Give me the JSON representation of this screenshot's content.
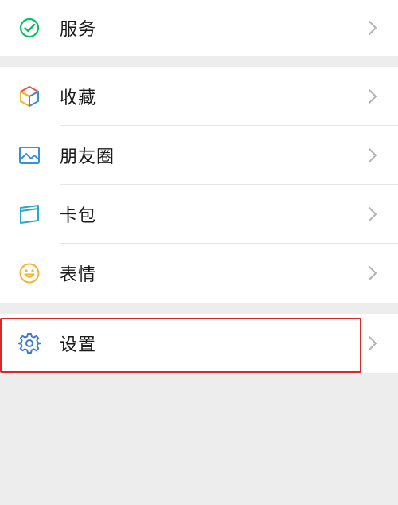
{
  "colors": {
    "background": "#ededed",
    "card": "#ffffff",
    "text": "#1a1a1a",
    "chevron": "#b3b3b3",
    "highlight": "#d6282a",
    "services_green": "#07c160",
    "moments_blue": "#3b8fd8",
    "cards_teal": "#2aa6c7",
    "sticker_yellow": "#f3b430",
    "settings_blue": "#3d7bd6"
  },
  "menu": {
    "services": {
      "label": "服务",
      "icon": "services-icon"
    },
    "favorites": {
      "label": "收藏",
      "icon": "cube-icon"
    },
    "moments": {
      "label": "朋友圈",
      "icon": "picture-icon"
    },
    "cards": {
      "label": "卡包",
      "icon": "card-icon"
    },
    "stickers": {
      "label": "表情",
      "icon": "smiley-icon"
    },
    "settings": {
      "label": "设置",
      "icon": "gear-icon"
    }
  }
}
